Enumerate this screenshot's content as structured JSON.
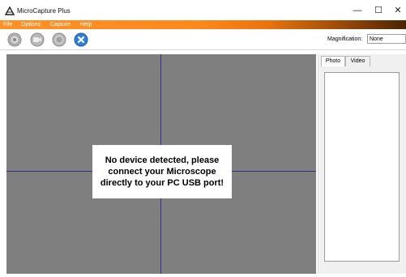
{
  "window": {
    "title": "MicroCapture Plus",
    "minimize_glyph": "—",
    "maximize_glyph": "☐",
    "close_glyph": "✕"
  },
  "menu": {
    "items": [
      {
        "label": "File"
      },
      {
        "label": "Options"
      },
      {
        "label": "Capture"
      },
      {
        "label": "Help"
      }
    ]
  },
  "toolbar": {
    "buttons": [
      {
        "icon": "settings-wheel-icon"
      },
      {
        "icon": "video-camera-icon"
      },
      {
        "icon": "capture-photo-icon"
      },
      {
        "icon": "stop-x-icon"
      }
    ],
    "magnification_label": "Magnification:",
    "magnification_value": "None"
  },
  "viewport": {
    "message": "No device detected, please\nconnect your Microscope\ndirectly to your PC USB port!"
  },
  "side_panel": {
    "tabs": [
      {
        "label": "Photo",
        "active": true
      },
      {
        "label": "Video",
        "active": false
      }
    ]
  },
  "colors": {
    "menubar_start": "#ff9128",
    "menubar_end": "#4b2404",
    "viewport_bg": "#7f7f7f",
    "crosshair": "#2f2f9a"
  }
}
